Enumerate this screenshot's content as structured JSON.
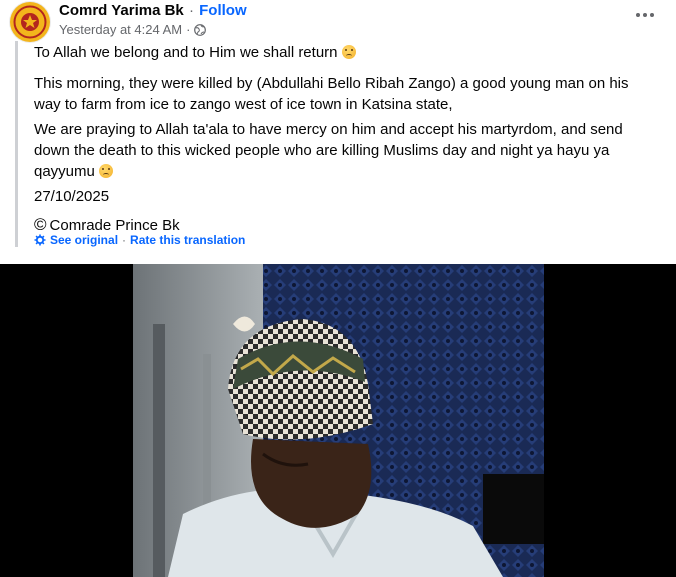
{
  "post": {
    "author": "Comrd Yarima Bk",
    "separator": "·",
    "follow_label": "Follow",
    "timestamp": "Yesterday at 4:24 AM",
    "meta_separator": "·",
    "privacy_icon": "globe-icon",
    "more_icon": "more-horizontal-icon",
    "avatar_text": "COMRD YARIMA BK"
  },
  "translation": {
    "para1": "To Allah we belong and to Him we shall return",
    "para2": "This morning, they were killed by (Abdullahi Bello Ribah Zango) a good young man on his way to farm from ice to zango west of ice town in Katsina state,",
    "para3": "We are praying to Allah ta'ala to have mercy on him and accept his martyrdom, and send down the death to this wicked people who are killing Muslims day and night ya hayu ya qayyumu",
    "date": "27/10/2025",
    "credit_symbol": "©",
    "credit": "Comrade Prince Bk",
    "see_original": "See original",
    "dot": "·",
    "rate": "Rate this translation",
    "emoji": "sad-face-emoji"
  },
  "colors": {
    "link": "#0866ff",
    "muted": "#65676b",
    "avatar_bg": "#f3b51c",
    "quote_bar": "#ced0d4",
    "photo_bg": "#000000"
  }
}
